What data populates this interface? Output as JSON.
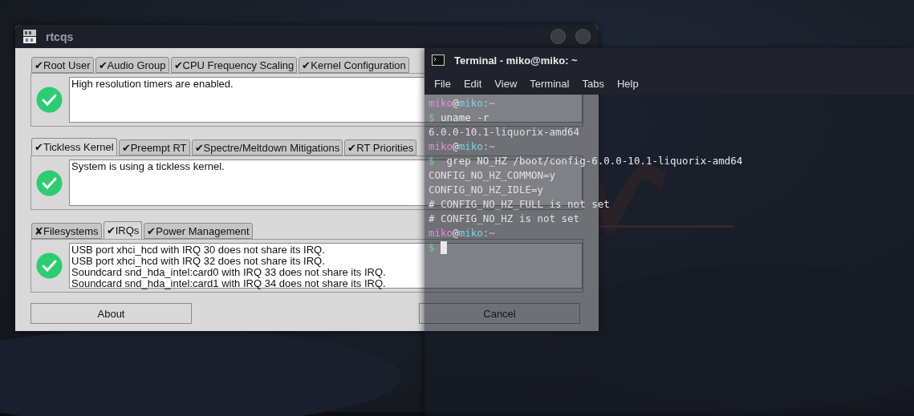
{
  "rtcqs_window": {
    "title": "rtcqs",
    "groups": [
      {
        "tabs": [
          {
            "label": "✔Root User",
            "selected": false
          },
          {
            "label": "✔Audio Group",
            "selected": false
          },
          {
            "label": "✔CPU Frequency Scaling",
            "selected": false
          },
          {
            "label": "✔Kernel Configuration",
            "selected": false
          }
        ],
        "ok": true,
        "messages": [
          "High resolution timers are enabled."
        ]
      },
      {
        "tabs": [
          {
            "label": "✔Tickless Kernel",
            "selected": true
          },
          {
            "label": "✔Preempt RT",
            "selected": false
          },
          {
            "label": "✔Spectre/Meltdown Mitigations",
            "selected": false
          },
          {
            "label": "✔RT Priorities",
            "selected": false
          }
        ],
        "ok": true,
        "messages": [
          "System is using a tickless kernel."
        ]
      },
      {
        "tabs": [
          {
            "label": "✘Filesystems",
            "selected": false
          },
          {
            "label": "✔IRQs",
            "selected": true
          },
          {
            "label": "✔Power Management",
            "selected": false
          }
        ],
        "ok": true,
        "messages": [
          "USB port xhci_hcd with IRQ 30 does not share its IRQ.",
          "USB port xhci_hcd with IRQ 32 does not share its IRQ.",
          "Soundcard snd_hda_intel:card0 with IRQ 33 does not share its IRQ.",
          "Soundcard snd_hda_intel:card1 with IRQ 34 does not share its IRQ."
        ]
      }
    ],
    "buttons": [
      "About",
      "Cancel"
    ]
  },
  "terminal_window": {
    "title": "Terminal - miko@miko: ~",
    "menu": [
      "File",
      "Edit",
      "View",
      "Terminal",
      "Tabs",
      "Help"
    ],
    "lines": [
      {
        "kind": "prompt",
        "user": "miko",
        "at": "@",
        "host": "miko",
        "path": ":~"
      },
      {
        "kind": "command",
        "sign": "$",
        "text": "uname -r"
      },
      {
        "kind": "output",
        "text": "6.0.0-10.1-liquorix-amd64"
      },
      {
        "kind": "prompt",
        "user": "miko",
        "at": "@",
        "host": "miko",
        "path": ":~"
      },
      {
        "kind": "command",
        "sign": "$",
        "text": " grep NO_HZ /boot/config-6.0.0-10.1-liquorix-amd64"
      },
      {
        "kind": "output",
        "text": "CONFIG_NO_HZ_COMMON=y"
      },
      {
        "kind": "output",
        "text": "CONFIG_NO_HZ_IDLE=y"
      },
      {
        "kind": "output",
        "text": "# CONFIG_NO_HZ_FULL is not set"
      },
      {
        "kind": "output",
        "text": "# CONFIG_NO_HZ is not set"
      },
      {
        "kind": "prompt",
        "user": "miko",
        "at": "@",
        "host": "miko",
        "path": ":~"
      },
      {
        "kind": "command",
        "sign": "$",
        "cursor": true
      }
    ]
  }
}
